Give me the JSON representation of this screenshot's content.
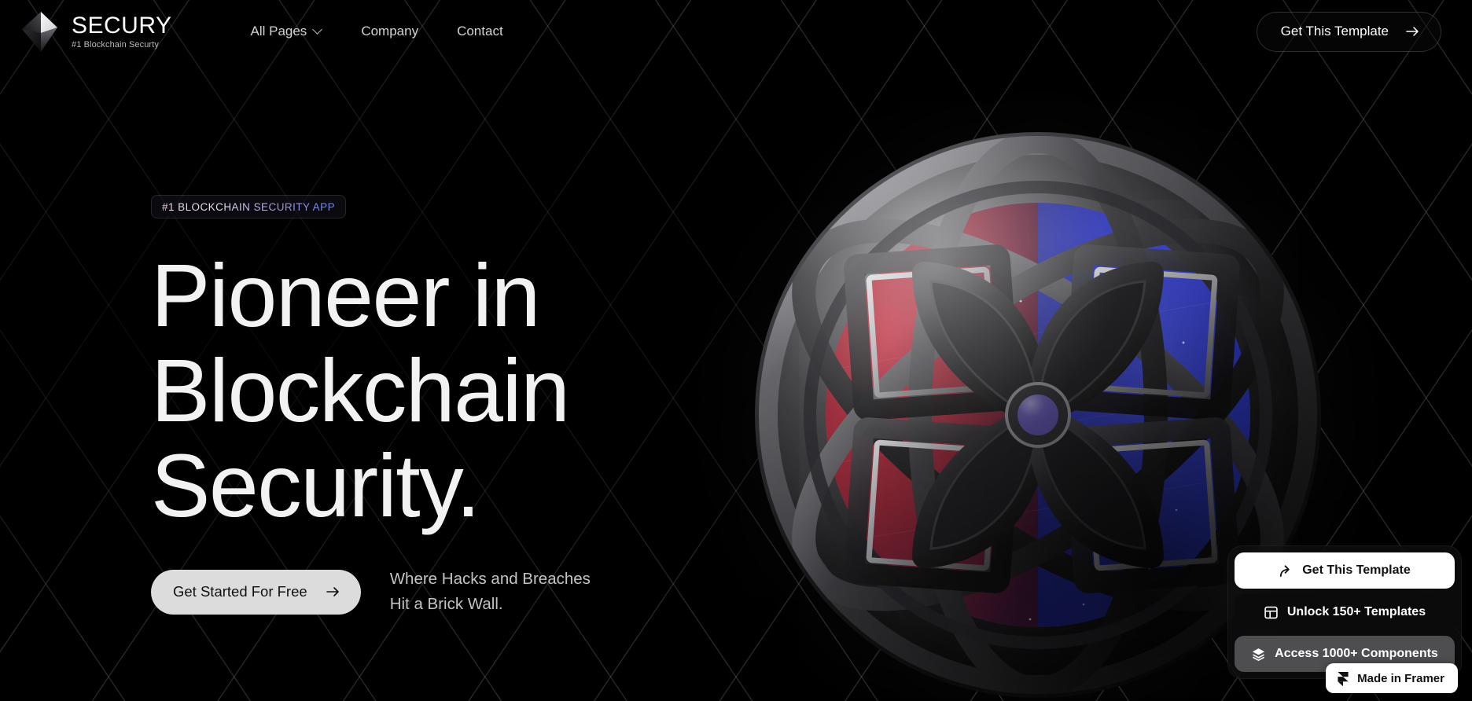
{
  "brand": {
    "name": "SECURY",
    "tagline": "#1 Blockchain Securty",
    "logo_icon": "diamond-octahedron-icon",
    "accent_start": "#efd9e4",
    "accent_end": "#6f86e8"
  },
  "nav": {
    "items": [
      {
        "label": "All Pages",
        "has_dropdown": true,
        "icon": "chevron-down-icon"
      },
      {
        "label": "Company",
        "has_dropdown": false
      },
      {
        "label": "Contact",
        "has_dropdown": false
      }
    ],
    "cta": {
      "label": "Get This Template",
      "icon": "arrow-right-icon"
    }
  },
  "hero": {
    "badge": "#1 BLOCKCHAIN SECURITY APP",
    "headline_lines": [
      "Pioneer in",
      "Blockchain",
      "Security."
    ],
    "cta": {
      "label": "Get Started For Free",
      "icon": "arrow-right-icon"
    },
    "tagline_lines": [
      "Where Hacks and Breaches",
      "Hit a Brick Wall."
    ]
  },
  "artwork": {
    "name": "blockchain-orb-3d",
    "description": "Dark metallic sphere with quatrefoil cutouts revealing red and blue starfield panels",
    "color_left": "#8e2330",
    "color_right": "#2a35b4",
    "metal_light": "#9a9a9e",
    "metal_dark": "#1b1b1d"
  },
  "widget": {
    "buttons": [
      {
        "label": "Get This Template",
        "icon": "share-arrow-icon",
        "style": "light"
      },
      {
        "label": "Unlock 150+ Templates",
        "icon": "layout-grid-icon",
        "style": "dark"
      },
      {
        "label": "Access 1000+ Components",
        "icon": "layers-icon",
        "style": "grey"
      }
    ]
  },
  "framer_badge": {
    "label": "Made in Framer",
    "icon": "framer-logo-icon"
  }
}
